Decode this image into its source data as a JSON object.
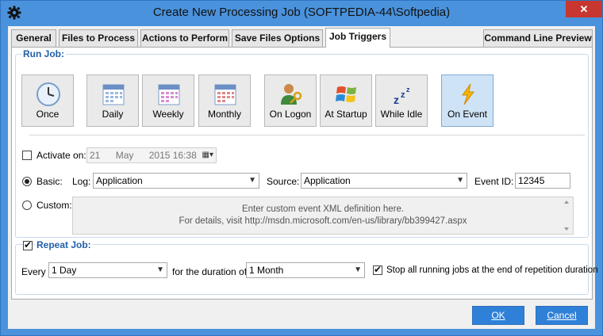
{
  "window": {
    "title": "Create New Processing Job (SOFTPEDIA-44\\Softpedia)",
    "close_label": "✕"
  },
  "tabs": [
    {
      "label": "General"
    },
    {
      "label": "Files to Process"
    },
    {
      "label": "Actions to Perform"
    },
    {
      "label": "Save Files Options"
    },
    {
      "label": "Job Triggers",
      "active": true
    },
    {
      "label": "Command Line Preview"
    }
  ],
  "run_job": {
    "group_label": "Run Job:",
    "buttons": [
      {
        "label": "Once",
        "icon": "clock-icon"
      },
      {
        "label": "Daily",
        "icon": "calendar-icon"
      },
      {
        "label": "Weekly",
        "icon": "calendar-icon"
      },
      {
        "label": "Monthly",
        "icon": "calendar-icon"
      },
      {
        "label": "On Logon",
        "icon": "user-key-icon"
      },
      {
        "label": "At Startup",
        "icon": "windows-logo-icon"
      },
      {
        "label": "While Idle",
        "icon": "sleep-zzz-icon"
      },
      {
        "label": "On Event",
        "icon": "lightning-icon",
        "selected": true
      }
    ],
    "activate_label": "Activate on:",
    "activate_checked": false,
    "activate_day": "21",
    "activate_month": "May",
    "activate_year_time": "2015 16:38",
    "basic_label": "Basic:",
    "basic_selected": true,
    "log_label": "Log:",
    "log_value": "Application",
    "source_label": "Source:",
    "source_value": "Application",
    "event_id_label": "Event ID:",
    "event_id_value": "12345",
    "custom_label": "Custom:",
    "custom_line1": "Enter custom event XML definition here.",
    "custom_line2": "For details, visit http://msdn.microsoft.com/en-us/library/bb399427.aspx"
  },
  "repeat_job": {
    "group_label": "Repeat Job:",
    "checked": true,
    "every_label": "Every",
    "every_value": "1 Day",
    "duration_label": "for the duration of:",
    "duration_value": "1 Month",
    "stop_label": "Stop all running jobs at the end of repetition duration",
    "stop_checked": true
  },
  "footer": {
    "ok_label": "OK",
    "cancel_label": "Cancel"
  },
  "colors": {
    "title_bg": "#4a92dc",
    "accent": "#2f80d8",
    "group_text": "#1f5fa8",
    "close_red": "#c7372f"
  }
}
